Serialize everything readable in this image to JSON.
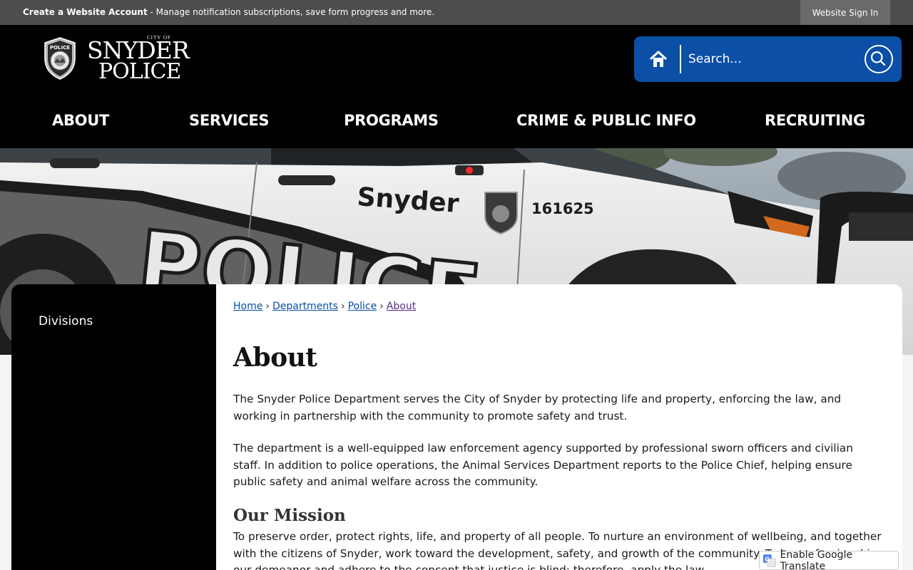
{
  "topbar": {
    "account_link": "Create a Website Account",
    "account_msg": " - Manage notification subscriptions, save form progress and more.",
    "signin": "Website Sign In"
  },
  "logo": {
    "city_of": "CITY OF",
    "name_line1": "SNYDER",
    "name_line2": "POLICE",
    "badge_text": "POLICE"
  },
  "search": {
    "placeholder": "Search..."
  },
  "nav": [
    "ABOUT",
    "SERVICES",
    "PROGRAMS",
    "CRIME & PUBLIC INFO",
    "RECRUITING"
  ],
  "hero": {
    "car_text": "POLICE",
    "car_city": "Snyder",
    "car_number": "161625"
  },
  "sidebar": {
    "items": [
      "Divisions"
    ]
  },
  "breadcrumb": [
    "Home",
    "Departments",
    "Police",
    "About"
  ],
  "page": {
    "title": "About",
    "paragraph1": "The Snyder Police Department serves the City of Snyder by protecting life and property, enforcing the law, and working in partnership with the community to promote safety and trust.",
    "paragraph2": "The department is a well-equipped law enforcement agency supported by professional sworn officers and civilian staff. In addition to police operations, the Animal Services Department reports to the Police Chief, helping ensure public safety and animal welfare across the community.",
    "mission_heading": "Our Mission",
    "mission_text": "To preserve order, protect rights, life, and property of all people. To nurture an environment of wellbeing, and together with the citizens of Snyder, work toward the development, safety, and growth of the community. To be professional in our demeanor and adhere to the concept that justice is blind; therefore, apply the law"
  },
  "translate": {
    "label": "Enable Google Translate"
  },
  "colors": {
    "topbar": "#4d4d4d",
    "header": "#000000",
    "search_bg": "#0b4fa7",
    "link": "#0b4fa7"
  }
}
